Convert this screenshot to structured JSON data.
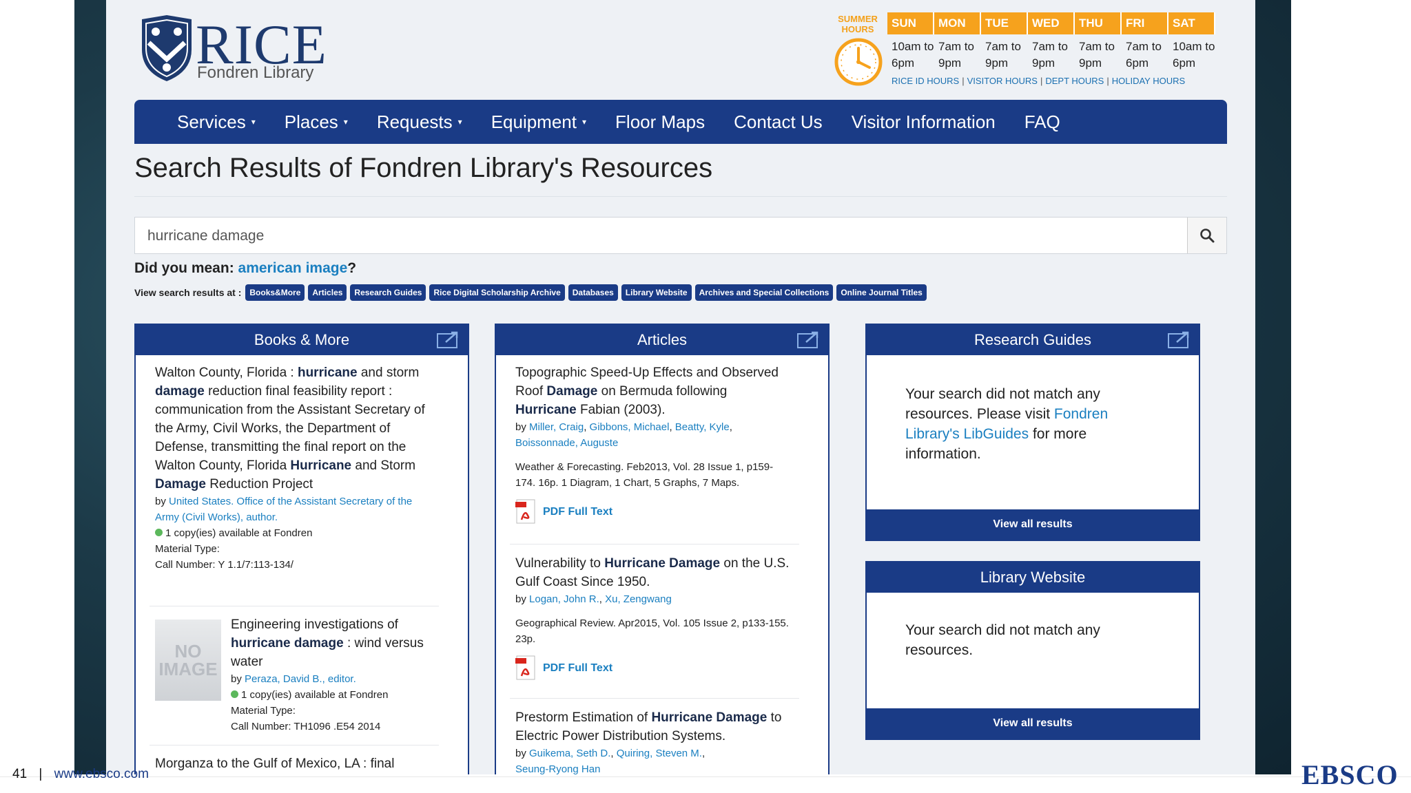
{
  "logo": {
    "brand": "RICE",
    "subtitle": "Fondren Library"
  },
  "hours": {
    "badge_line1": "SUMMER",
    "badge_line2": "HOURS",
    "days": [
      {
        "day": "SUN",
        "open": "10am to",
        "close": "6pm"
      },
      {
        "day": "MON",
        "open": "7am to",
        "close": "9pm"
      },
      {
        "day": "TUE",
        "open": "7am to",
        "close": "9pm"
      },
      {
        "day": "WED",
        "open": "7am to",
        "close": "9pm"
      },
      {
        "day": "THU",
        "open": "7am to",
        "close": "9pm"
      },
      {
        "day": "FRI",
        "open": "7am to",
        "close": "6pm"
      },
      {
        "day": "SAT",
        "open": "10am to",
        "close": "6pm"
      }
    ],
    "links": [
      "RICE ID HOURS",
      "VISITOR HOURS",
      "DEPT HOURS",
      "HOLIDAY HOURS"
    ]
  },
  "nav": {
    "services": "Services",
    "places": "Places",
    "requests": "Requests",
    "equipment": "Equipment",
    "floor_maps": "Floor Maps",
    "contact_us": "Contact Us",
    "visitor_info": "Visitor Information",
    "faq": "FAQ"
  },
  "page_title": "Search Results of Fondren Library's Resources",
  "search": {
    "value": "hurricane damage"
  },
  "did_you_mean": {
    "label": "Did you mean:",
    "suggestion": "american image",
    "suffix": "?"
  },
  "view_results": {
    "label": "View search results at :",
    "targets": [
      "Books&More",
      "Articles",
      "Research Guides",
      "Rice Digital Scholarship Archive",
      "Databases",
      "Library Website",
      "Archives and Special Collections",
      "Online Journal Titles"
    ]
  },
  "books": {
    "title": "Books & More",
    "item1": {
      "t1": "Walton County, Florida : ",
      "b1": "hurricane",
      "t2": " and storm ",
      "b2": "damage",
      "t3": " reduction final feasibility report : communication from the Assistant Secretary of the Army, Civil Works, the Department of Defense, transmitting the final report on the Walton County, Florida ",
      "b3": "Hurricane",
      "t4": " and Storm ",
      "b4": "Damage",
      "t5": " Reduction Project",
      "by": "by ",
      "author": "United States. Office of the Assistant Secretary of the Army (Civil Works), author.",
      "availability": "1 copy(ies) available at Fondren",
      "material": "Material Type:",
      "call": "Call Number: Y 1.1/7:113-134/"
    },
    "item2": {
      "t1": "Engineering investigations of ",
      "b1": "hurricane damage",
      "t2": " : wind versus water",
      "by": "by ",
      "author": "Peraza, David B., editor.",
      "availability": "1 copy(ies) available at Fondren",
      "material": "Material Type:",
      "call": "Call Number: TH1096 .E54 2014",
      "noimg1": "NO",
      "noimg2": "IMAGE"
    },
    "item3": {
      "t1": "Morganza to the Gulf of Mexico, LA : final"
    }
  },
  "articles": {
    "title": "Articles",
    "item1": {
      "t1": "Topographic Speed-Up Effects and Observed Roof ",
      "b1": "Damage",
      "t2": " on Bermuda following ",
      "b2": "Hurricane",
      "t3": " Fabian (2003).",
      "by": "by ",
      "authors": [
        "Miller, Craig",
        "Gibbons, Michael",
        "Beatty, Kyle",
        "Boissonnade, Auguste"
      ],
      "source": "Weather & Forecasting. Feb2013, Vol. 28 Issue 1, p159-174. 16p. 1 Diagram, 1 Chart, 5 Graphs, 7 Maps.",
      "pdf": "PDF Full Text"
    },
    "item2": {
      "t1": "Vulnerability to ",
      "b1": "Hurricane Damage",
      "t2": " on the U.S. Gulf Coast Since 1950.",
      "by": "by ",
      "authors": [
        "Logan, John R.",
        "Xu, Zengwang"
      ],
      "source": "Geographical Review. Apr2015, Vol. 105 Issue 2, p133-155. 23p.",
      "pdf": "PDF Full Text"
    },
    "item3": {
      "t1": "Prestorm Estimation of ",
      "b1": "Hurricane Damage",
      "t2": " to Electric Power Distribution Systems.",
      "by": "by ",
      "authors": [
        "Guikema, Seth D.",
        "Quiring, Steven M.",
        "Seung-Ryong Han"
      ]
    }
  },
  "guides": {
    "title": "Research Guides",
    "msg1": "Your search did not match any resources. Please visit ",
    "link": "Fondren Library's LibGuides",
    "msg2": " for more information.",
    "view_all": "View all results"
  },
  "website": {
    "title": "Library Website",
    "msg": "Your search did not match any resources.",
    "view_all": "View all results"
  },
  "footer": {
    "page": "41",
    "sep": "|",
    "url": "www.ebsco.com",
    "brand": "EBSCO"
  },
  "colors": {
    "navy": "#1a3b86",
    "orange": "#f6a21d",
    "link": "#1a7fc0",
    "available": "#5cb85c"
  }
}
